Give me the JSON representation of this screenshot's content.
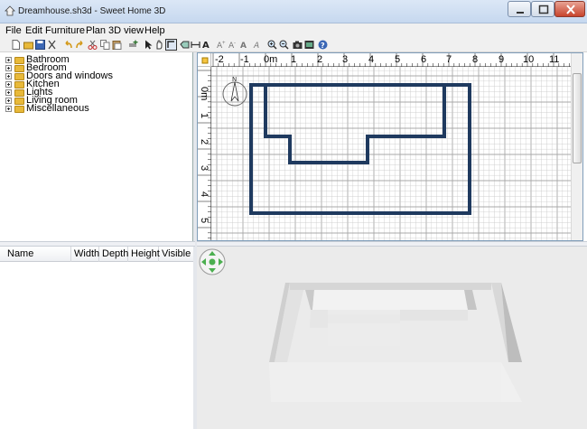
{
  "window": {
    "title": "Dreamhouse.sh3d - Sweet Home 3D"
  },
  "menu": [
    "File",
    "Edit",
    "Furniture",
    "Plan",
    "3D view",
    "Help"
  ],
  "toolbar": {
    "buttons": [
      "new-icon",
      "open-icon",
      "save-icon",
      "cut-icon",
      "undo-icon",
      "redo-icon",
      "cut-icon",
      "copy-icon",
      "paste-icon",
      "add-furniture-icon",
      "select-mode-icon",
      "pan-mode-icon",
      "create-walls-icon",
      "create-rooms-icon",
      "create-dimensions-icon",
      "add-text-icon",
      "increase-text-icon",
      "decrease-text-icon",
      "bold-icon",
      "italic-icon",
      "zoom-in-icon",
      "zoom-out-icon",
      "create-photo-icon",
      "create-video-icon",
      "help-icon"
    ]
  },
  "catalog": {
    "categories": [
      "Bathroom",
      "Bedroom",
      "Doors and windows",
      "Kitchen",
      "Lights",
      "Living room",
      "Miscellaneous"
    ]
  },
  "furniture_table": {
    "columns": [
      "Name",
      "Width",
      "Depth",
      "Height",
      "Visible"
    ]
  },
  "plan": {
    "ruler_top": [
      "-2",
      "-1",
      "0m",
      "1",
      "2",
      "3",
      "4",
      "5",
      "6",
      "7",
      "8",
      "9",
      "10",
      "11"
    ],
    "ruler_left": [
      "0m",
      "1",
      "2",
      "3",
      "4",
      "5"
    ],
    "wall_color": "#1f3a5f",
    "grid_color": "#c8c8c8"
  },
  "view3d": {
    "background": "#ebebeb",
    "nav_color": "#4caf50"
  }
}
